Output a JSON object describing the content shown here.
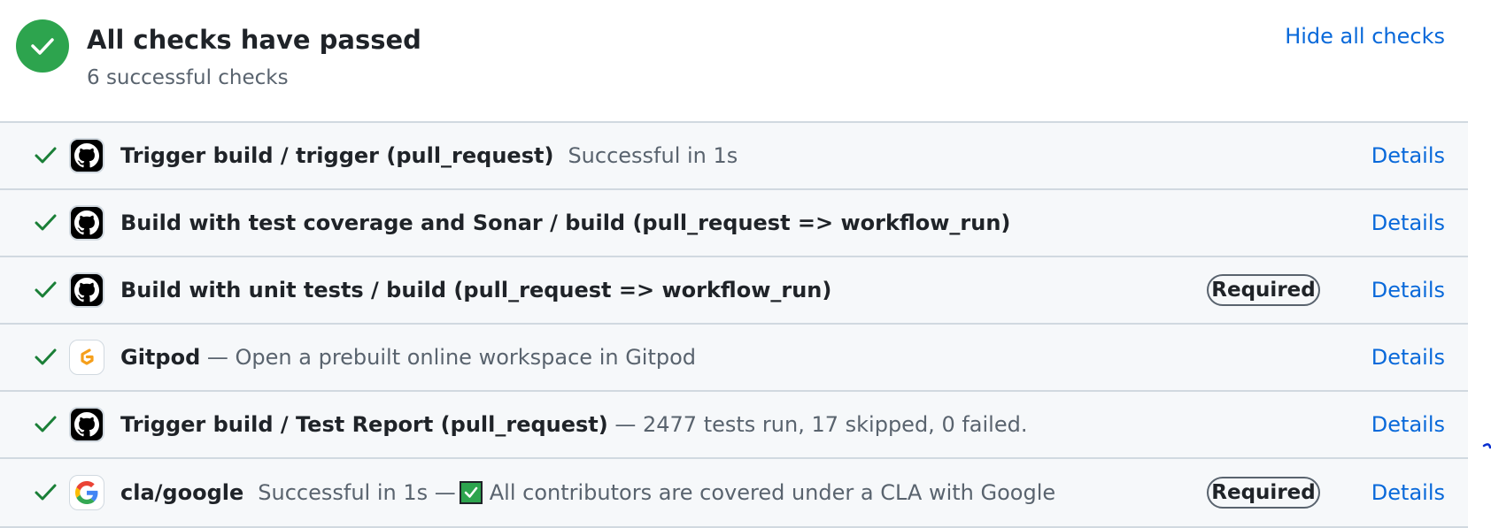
{
  "summary": {
    "title": "All checks have passed",
    "subtitle": "6 successful checks",
    "hide_label": "Hide all checks"
  },
  "checks": [
    {
      "name": "Trigger build / trigger (pull_request)",
      "separator": "",
      "description": "Successful in 1s",
      "description_tail": "",
      "avatar": "github-icon",
      "required": "",
      "details": "Details"
    },
    {
      "name": "Build with test coverage and Sonar / build (pull_request => workflow_run)",
      "separator": "",
      "description": "",
      "description_tail": "",
      "avatar": "github-icon",
      "required": "",
      "details": "Details"
    },
    {
      "name": "Build with unit tests / build (pull_request => workflow_run)",
      "separator": "",
      "description": "",
      "description_tail": "",
      "avatar": "github-icon",
      "required": "Required",
      "details": "Details"
    },
    {
      "name": "Gitpod",
      "separator": " — ",
      "description": "Open a prebuilt online workspace in Gitpod",
      "description_tail": "",
      "avatar": "gitpod-icon",
      "required": "",
      "details": "Details"
    },
    {
      "name": "Trigger build / Test Report (pull_request)",
      "separator": " — ",
      "description": "2477 tests run, 17 skipped, 0 failed.",
      "description_tail": "",
      "avatar": "github-icon",
      "required": "",
      "details": "Details"
    },
    {
      "name": "cla/google",
      "separator": "",
      "description": "Successful in 1s —",
      "description_tail": "All contributors are covered under a CLA with Google",
      "avatar": "google-icon",
      "required": "Required",
      "details": "Details"
    }
  ],
  "colors": {
    "success": "#2da44e",
    "link": "#0969da",
    "row_bg": "#f6f8fa",
    "border": "#d1d9e0"
  }
}
